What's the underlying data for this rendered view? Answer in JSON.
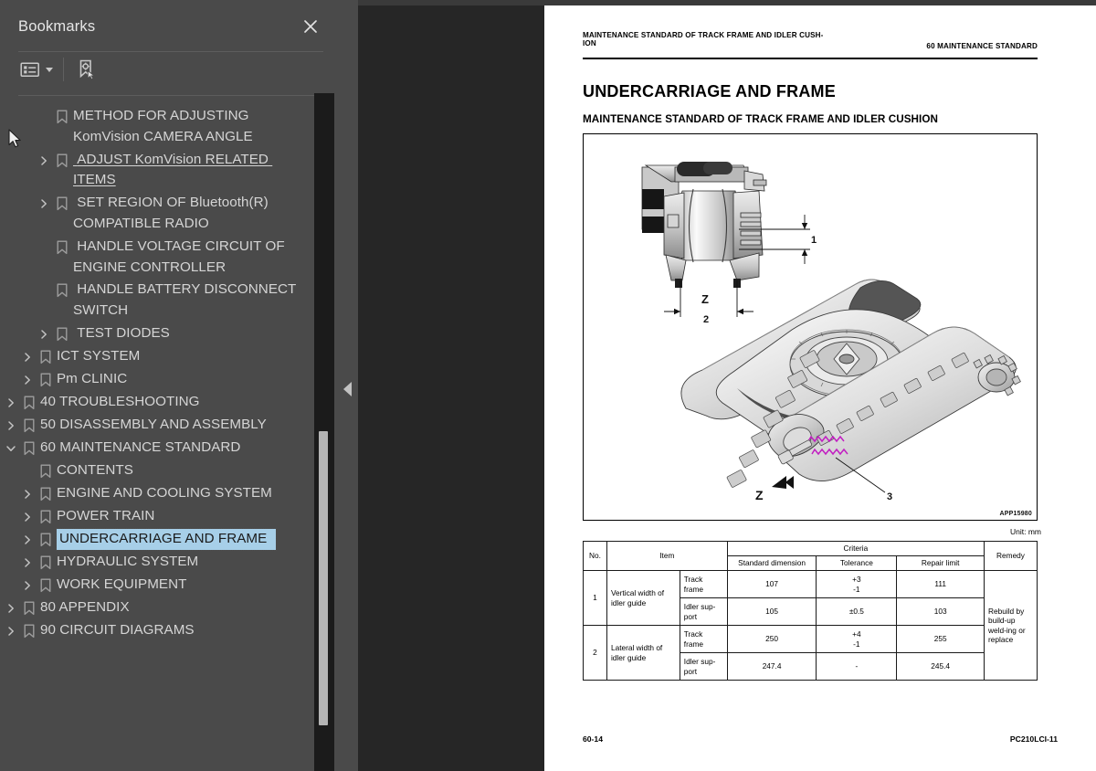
{
  "panel": {
    "title": "Bookmarks",
    "close_icon": "close-icon",
    "toolbar": {
      "options_icon": "list-options-icon",
      "new_bookmark_icon": "new-bookmark-icon"
    },
    "items": [
      {
        "label": "METHOD FOR ADJUSTING KomVision CAMERA ANGLE",
        "level": 2,
        "expandable": false,
        "selected": false,
        "underlined": false
      },
      {
        "label": " ADJUST KomVision RELATED ITEMS",
        "level": 2,
        "expandable": true,
        "selected": false,
        "underlined": true
      },
      {
        "label": " SET REGION OF Bluetooth(R) COMPATIBLE RADIO",
        "level": 2,
        "expandable": true,
        "selected": false,
        "underlined": false
      },
      {
        "label": " HANDLE VOLTAGE CIRCUIT OF ENGINE CONTROLLER",
        "level": 2,
        "expandable": false,
        "selected": false,
        "underlined": false
      },
      {
        "label": " HANDLE BATTERY DISCONNECT SWITCH",
        "level": 2,
        "expandable": false,
        "selected": false,
        "underlined": false
      },
      {
        "label": " TEST DIODES",
        "level": 2,
        "expandable": true,
        "selected": false,
        "underlined": false
      },
      {
        "label": "ICT SYSTEM",
        "level": 1,
        "expandable": true,
        "selected": false,
        "underlined": false
      },
      {
        "label": "Pm CLINIC",
        "level": 1,
        "expandable": true,
        "selected": false,
        "underlined": false
      },
      {
        "label": "40 TROUBLESHOOTING",
        "level": 0,
        "expandable": true,
        "selected": false,
        "underlined": false
      },
      {
        "label": "50 DISASSEMBLY AND ASSEMBLY",
        "level": 0,
        "expandable": true,
        "selected": false,
        "underlined": false
      },
      {
        "label": "60 MAINTENANCE STANDARD",
        "level": 0,
        "expandable": true,
        "expanded": true,
        "selected": false,
        "underlined": false
      },
      {
        "label": "CONTENTS",
        "level": 1,
        "expandable": false,
        "selected": false,
        "underlined": false
      },
      {
        "label": "ENGINE AND COOLING SYSTEM",
        "level": 1,
        "expandable": true,
        "selected": false,
        "underlined": false
      },
      {
        "label": "POWER TRAIN",
        "level": 1,
        "expandable": true,
        "selected": false,
        "underlined": false
      },
      {
        "label": "UNDERCARRIAGE AND FRAME",
        "level": 1,
        "expandable": true,
        "selected": true,
        "underlined": false
      },
      {
        "label": "HYDRAULIC SYSTEM",
        "level": 1,
        "expandable": true,
        "selected": false,
        "underlined": false
      },
      {
        "label": "WORK EQUIPMENT",
        "level": 1,
        "expandable": true,
        "selected": false,
        "underlined": false
      },
      {
        "label": "80 APPENDIX",
        "level": 0,
        "expandable": true,
        "selected": false,
        "underlined": false
      },
      {
        "label": "90 CIRCUIT DIAGRAMS",
        "level": 0,
        "expandable": true,
        "selected": false,
        "underlined": false
      }
    ]
  },
  "document": {
    "running_head_left": "MAINTENANCE STANDARD OF TRACK FRAME AND IDLER CUSH-\nION",
    "running_head_right": "60 MAINTENANCE STANDARD",
    "section_title": "UNDERCARRIAGE AND FRAME",
    "sub_title": "MAINTENANCE STANDARD OF TRACK FRAME AND IDLER CUSHION",
    "figure_id": "APP15980",
    "figure_callouts": [
      "1",
      "2",
      "3",
      "Z",
      "Z"
    ],
    "unit_note": "Unit: mm",
    "footer_left": "60-14",
    "footer_right": "PC210LCI-11",
    "table": {
      "headers_row1": [
        "No.",
        "Item",
        "Criteria",
        "Remedy"
      ],
      "headers_row2": [
        "Standard dimension",
        "Tolerance",
        "Repair limit"
      ],
      "rows": [
        {
          "no": "1",
          "item": "Vertical width of idler guide",
          "sub": "Track frame",
          "standard": "107",
          "tolerance": "+3\n-1",
          "repair": "111"
        },
        {
          "no": "",
          "item": "",
          "sub": "Idler sup-port",
          "standard": "105",
          "tolerance": "±0.5",
          "repair": "103"
        },
        {
          "no": "2",
          "item": "Lateral width of idler guide",
          "sub": "Track frame",
          "standard": "250",
          "tolerance": "+4\n-1",
          "repair": "255"
        },
        {
          "no": "",
          "item": "",
          "sub": "Idler sup-port",
          "standard": "247.4",
          "tolerance": "-",
          "repair": "245.4"
        }
      ],
      "remedy": "Rebuild by build-up weld-ing or replace"
    }
  },
  "colors": {
    "panel_bg": "#4a4a4a",
    "viewer_bg": "#262626",
    "selection": "#a7cfe8",
    "text": "#d5d5d5",
    "scrollbar_thumb": "#b4b4b4"
  }
}
